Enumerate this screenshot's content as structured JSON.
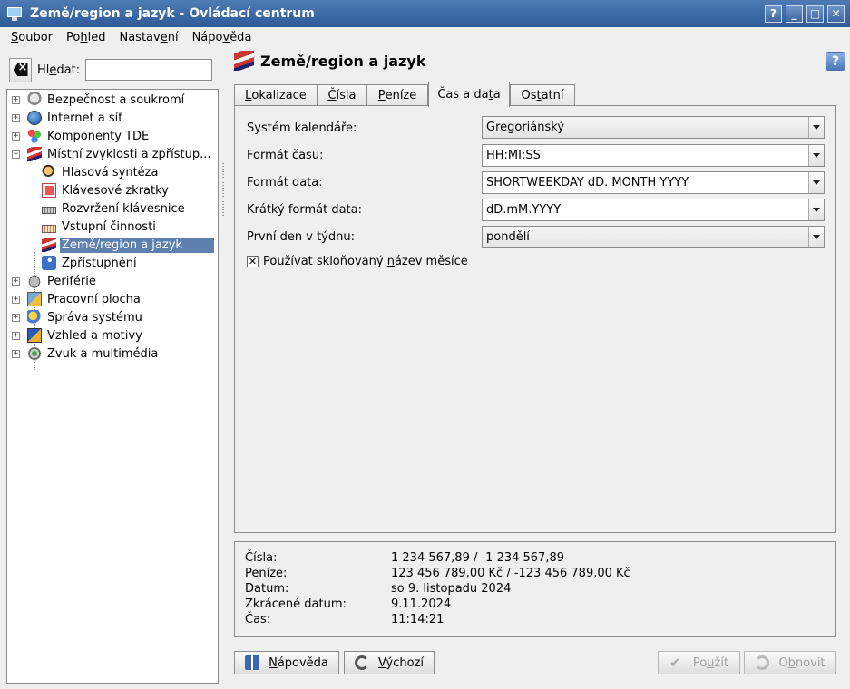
{
  "window": {
    "title": "Země/region a jazyk - Ovládací centrum",
    "buttons": {
      "help": "?",
      "minimize": "_",
      "maximize": "□",
      "close": "✕"
    }
  },
  "menubar": [
    {
      "pre": "",
      "ul": "S",
      "post": "oubor"
    },
    {
      "pre": "Po",
      "ul": "h",
      "post": "led"
    },
    {
      "pre": "Nastav",
      "ul": "e",
      "post": "ní"
    },
    {
      "pre": "Nápo",
      "ul": "v",
      "post": "ěda"
    }
  ],
  "search": {
    "label_pre": "Hl",
    "label_ul": "e",
    "label_post": "dat:",
    "value": "",
    "placeholder": ""
  },
  "tree": {
    "items": [
      {
        "label": "Bezpečnost a soukromí",
        "icon": "lock-icon",
        "expander": "+"
      },
      {
        "label": "Internet a síť",
        "icon": "globe-icon",
        "expander": "+"
      },
      {
        "label": "Komponenty TDE",
        "icon": "components-icon",
        "expander": "+"
      },
      {
        "label": "Místní zvyklosti a zpřístup...",
        "icon": "flag-icon",
        "expander": "−"
      },
      {
        "label": "Hlasová syntéza",
        "icon": "speech-icon"
      },
      {
        "label": "Klávesové zkratky",
        "icon": "shortcut-icon"
      },
      {
        "label": "Rozvržení klávesnice",
        "icon": "keyboard-icon"
      },
      {
        "label": "Vstupní činnosti",
        "icon": "input-actions-icon"
      },
      {
        "label": "Země/region a jazyk",
        "icon": "flag-icon",
        "selected": true
      },
      {
        "label": "Zpřístupnění",
        "icon": "accessibility-icon"
      },
      {
        "label": "Periférie",
        "icon": "peripherals-icon",
        "expander": "+"
      },
      {
        "label": "Pracovní plocha",
        "icon": "desktop-icon",
        "expander": "+"
      },
      {
        "label": "Správa systému",
        "icon": "system-admin-icon",
        "expander": "+"
      },
      {
        "label": "Vzhled a motivy",
        "icon": "appearance-icon",
        "expander": "+"
      },
      {
        "label": "Zvuk a multimédia",
        "icon": "sound-icon",
        "expander": "+"
      }
    ]
  },
  "page": {
    "title": "Země/region a jazyk",
    "help_glyph": "?"
  },
  "tabs": [
    {
      "pre": "",
      "ul": "L",
      "post": "okalizace"
    },
    {
      "pre": "",
      "ul": "Č",
      "post": "ísla"
    },
    {
      "pre": "",
      "ul": "P",
      "post": "eníze"
    },
    {
      "pre": "Čas a da",
      "ul": "t",
      "post": "a",
      "active": true
    },
    {
      "pre": "Os",
      "ul": "t",
      "post": "atní"
    }
  ],
  "form": {
    "calendar_label": "Systém kalendáře:",
    "calendar_value": "Gregoriánský",
    "time_format_label": "Formát času:",
    "time_format_value": "HH:MI:SS",
    "date_format_label": "Formát data:",
    "date_format_value": "SHORTWEEKDAY dD. MONTH YYYY",
    "short_date_label": "Krátký formát data:",
    "short_date_value": "dD.mM.YYYY",
    "first_day_label": "První den v týdnu:",
    "first_day_value": "pondělí",
    "declined_month_checked": true,
    "declined_month_pre": "Používat skloňovaný ",
    "declined_month_ul": "n",
    "declined_month_post": "ázev měsíce"
  },
  "preview": [
    {
      "label": "Čísla:",
      "value": "1 234 567,89 / -1 234 567,89"
    },
    {
      "label": "Peníze:",
      "value": "123 456 789,00 Kč / -123 456 789,00 Kč"
    },
    {
      "label": "Datum:",
      "value": "so 9. listopadu 2024"
    },
    {
      "label": "Zkrácené datum:",
      "value": "9.11.2024"
    },
    {
      "label": "Čas:",
      "value": "11:14:21"
    }
  ],
  "buttons": {
    "help": {
      "pre": "",
      "ul": "N",
      "post": "ápověda"
    },
    "defaults": {
      "pre": "",
      "ul": "V",
      "post": "ýchozí"
    },
    "apply": {
      "pre": "Po",
      "ul": "u",
      "post": "žít"
    },
    "reset": {
      "pre": "O",
      "ul": "b",
      "post": "novit"
    }
  }
}
